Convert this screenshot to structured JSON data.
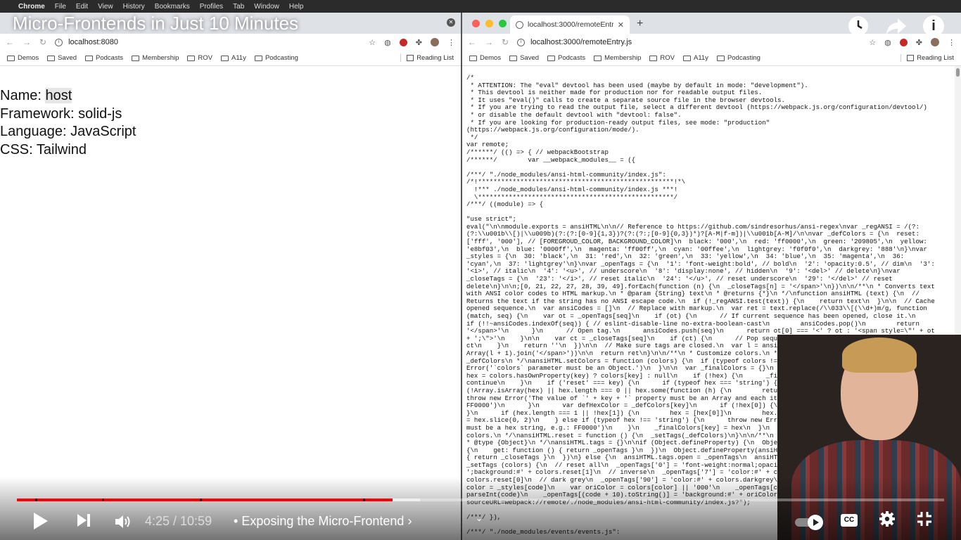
{
  "menubar": {
    "app": "Chrome",
    "items": [
      "File",
      "Edit",
      "View",
      "History",
      "Bookmarks",
      "Profiles",
      "Tab",
      "Window",
      "Help"
    ]
  },
  "video": {
    "title": "Micro-Frontends in Just 10 Minutes",
    "time": "4:25 / 10:59",
    "separator": "•",
    "chapter": "Exposing the Micro-Frontend",
    "chapter_chevron": "›",
    "progress_played_fraction": 0.405,
    "progress_loaded_fraction": 0.435,
    "chapter_markers_fraction": [
      0.02,
      0.092,
      0.197,
      0.373
    ],
    "cc_label": "CC",
    "accent": "#ff0000"
  },
  "left_browser": {
    "address": "localhost:8080",
    "bookmarks": [
      "Demos",
      "Saved",
      "Podcasts",
      "Membership",
      "ROV",
      "A11y",
      "Podcasting"
    ],
    "reading_list": "Reading List",
    "page": {
      "name_label": "Name:",
      "name_value": "host",
      "framework": "Framework: solid-js",
      "language": "Language: JavaScript",
      "css": "CSS: Tailwind"
    }
  },
  "right_browser": {
    "tab_title": "localhost:3000/remoteEntry.js",
    "address": "localhost:3000/remoteEntry.js",
    "bookmarks": [
      "Demos",
      "Saved",
      "Podcasts",
      "Membership",
      "ROV",
      "A11y",
      "Podcasting"
    ],
    "reading_list": "Reading List",
    "code": "/*\n * ATTENTION: The \"eval\" devtool has been used (maybe by default in mode: \"development\").\n * This devtool is neither made for production nor for readable output files.\n * It uses \"eval()\" calls to create a separate source file in the browser devtools.\n * If you are trying to read the output file, select a different devtool (https://webpack.js.org/configuration/devtool/)\n * or disable the default devtool with \"devtool: false\".\n * If you are looking for production-ready output files, see mode: \"production\"\n(https://webpack.js.org/configuration/mode/).\n */\nvar remote;\n/******/ (() => { // webpackBootstrap\n/******/        var __webpack_modules__ = ({\n\n/***/ \"./node_modules/ansi-html-community/index.js\":\n/*!***************************************************!*\\\n  !*** ./node_modules/ansi-html-community/index.js ***!\n  \\***************************************************/\n/***/ ((module) => {\n\n\"use strict\";\neval(\"\\n\\nmodule.exports = ansiHTML\\n\\n// Reference to https://github.com/sindresorhus/ansi-regex\\nvar _regANSI = /(?:\n(?:\\\\u001b\\\\[)|\\\\u009b)(?:(?:[0-9]{1,3})?(?:(?:;[0-9]{0,3})*)?[A-M|f-m])|\\\\u001b[A-M]/\\n\\nvar _defColors = {\\n  reset:\n['fff', '000'], // [FOREGROUD_COLOR, BACKGROUND_COLOR]\\n  black: '000',\\n  red: 'ff0000',\\n  green: '209805',\\n  yellow:\n'e8bf03',\\n  blue: '0000ff',\\n  magenta: 'ff00ff',\\n  cyan: '00ffee',\\n  lightgrey: 'f0f0f0',\\n  darkgrey: '888'\\n}\\nvar\n_styles = {\\n  30: 'black',\\n  31: 'red',\\n  32: 'green',\\n  33: 'yellow',\\n  34: 'blue',\\n  35: 'magenta',\\n  36:\n'cyan',\\n  37: 'lightgrey'\\n}\\nvar _openTags = {\\n  '1': 'font-weight:bold', // bold\\n  '2': 'opacity:0.5', // dim\\n  '3':\n'<i>', // italic\\n  '4': '<u>', // underscore\\n  '8': 'display:none', // hidden\\n  '9': '<del>' // delete\\n}\\nvar\n_closeTags = {\\n  '23': '</i>', // reset italic\\n  '24': '</u>', // reset underscore\\n  '29': '</del>' // reset\ndelete\\n}\\n\\n;[0, 21, 22, 27, 28, 39, 49].forEach(function (n) {\\n  _closeTags[n] = '</span>'\\n})\\n\\n/**\\n * Converts text\nwith ANSI color codes to HTML markup.\\n * @param {String} text\\n * @returns {*}\\n */\\nfunction ansiHTML (text) {\\n  //\nReturns the text if the string has no ANSI escape code.\\n  if (!_regANSI.test(text)) {\\n    return text\\n  }\\n\\n  // Cache\nopened sequence.\\n  var ansiCodes = []\\n  // Replace with markup.\\n  var ret = text.replace(/\\\\033\\\\[(\\\\d+)m/g, function\n(match, seq) {\\n    var ot = _openTags[seq]\\n    if (ot) {\\n      // If current sequence has been opened, close it.\\n\nif (!!~ansiCodes.indexOf(seq)) { // eslint-disable-line no-extra-boolean-cast\\n        ansiCodes.pop()\\n        return\n'</span>'\\n      }\\n      // Open tag.\\n      ansiCodes.push(seq)\\n      return ot[0] === '<' ? ot : '<span style=\\\"' + ot\n+ ';\\\">'\\n    }\\n\\n    var ct = _closeTags[seq]\\n    if (ct) {\\n      // Pop sequence\\n      ansiCodes.pop()\\n      return\nct\\n    }\\n    return ''\\n  })\\n\\n  // Make sure tags are closed.\\n  var l = ansiCodes.length\\n  ;(l > 0) && (ret +=\nArray(l + 1).join('</span>'))\\n\\n  return ret\\n}\\n\\n/**\\n * Customize colors.\\n * @param {Object} colors reference to\n_defColors\\n */\\nansiHTML.setColors = function (colors) {\\n  if (typeof colors !== 'object') {\\n    throw new\nError('`colors` parameter must be an Object.')\\n  }\\n\\n  var _finalColors = {}\\n  for (var key in _defColors) {\\n    var\nhex = colors.hasOwnProperty(key) ? colors[key] : null\\n    if (!hex) {\\n      _finalColors[key] = _defColors[key]\\n\ncontinue\\n    }\\n    if ('reset' === key) {\\n      if (typeof hex === 'string') {\\n        hex = [hex]\\n      }\\n      if\n(!Array.isArray(hex) || hex.length === 0 || hex.some(function (h) {\\n        return typeof h !== 'string'\\n      })) {\\n\nthrow new Error('The value of `' + key + '` property must be an Array and each item could only be a hex string, e.g.:\nFF0000')\\n      }\\n      var defHexColor = _defColors[key]\\n      if (!hex[0]) {\\n        hex[0] = defHexColor[0]\\n\n}\\n      if (hex.length === 1 || !hex[1]) {\\n        hex = [hex[0]]\\n        hex.push(defHexColor[1])\\n      }\\n\\n      hex\n= hex.slice(0, 2)\\n    } else if (typeof hex !== 'string') {\\n      throw new Error('The value of `' + key + '` property\nmust be a hex string, e.g.: FF0000')\\n    }\\n    _finalColors[key] = hex\\n  }\\n  _setTags(_finalColors)\\n}\\n\\n/**\\n * Reset\ncolors.\\n */\\nansiHTML.reset = function () {\\n  _setTags(_defColors)\\n}\\n\\n/**\\n * Expose tags, including open and close.\\n\n* @type {Object}\\n */\\nansiHTML.tags = {}\\n\\nif (Object.defineProperty) {\\n  Object.defineProperty(ansiHTML.tags, 'open',\n{\\n    get: function () { return _openTags }\\n  })\\n  Object.defineProperty(ansiHTML.tags, 'close', {\\n    get: function ()\n{ return _closeTags }\\n  })\\n} else {\\n  ansiHTML.tags.open = _openTags\\n  ansiHTML.tags.close = _closeTags\\n}\\n\\nfunction\n_setTags (colors) {\\n  // reset all\\n  _openTags['0'] = 'font-weight:normal;opacity:1;color:#' + colors.reset[0] + '\n';background:#' + colors.reset[1]\\n  // inverse\\n  _openTags['7'] = 'color:#' + colors.reset[1] + ';background:#' +\ncolors.reset[0]\\n  // dark grey\\n  _openTags['90'] = 'color:#' + colors.darkgrey\\n\\n  for (var code in _styles) {\\n    var\ncolor = _styles[code]\\n    var oriColor = colors[color] || '000'\\n    _openTags[code] = 'color:#' + oriColor\\n    code =\nparseInt(code)\\n    _openTags[(code + 10).toString()] = 'background:#' + oriColor\\n  }\\n}\\n\\nansiHTML.reset()\\n\\n\\n//#\nsourceURL=webpack://remote/./node_modules/ansi-html-community/index.js?\");\n\n/***/ }),\n\n/***/ \"./node_modules/events/events.js\":"
  },
  "icons": {
    "watch_later": "clock-icon",
    "share": "share-icon",
    "info": "info-icon",
    "settings": "gear-icon",
    "fullscreen_exit": "exit-fullscreen-icon"
  },
  "colors": {
    "traffic_red": "#ff5f57",
    "traffic_yellow": "#febc2e",
    "traffic_green": "#28c840"
  }
}
